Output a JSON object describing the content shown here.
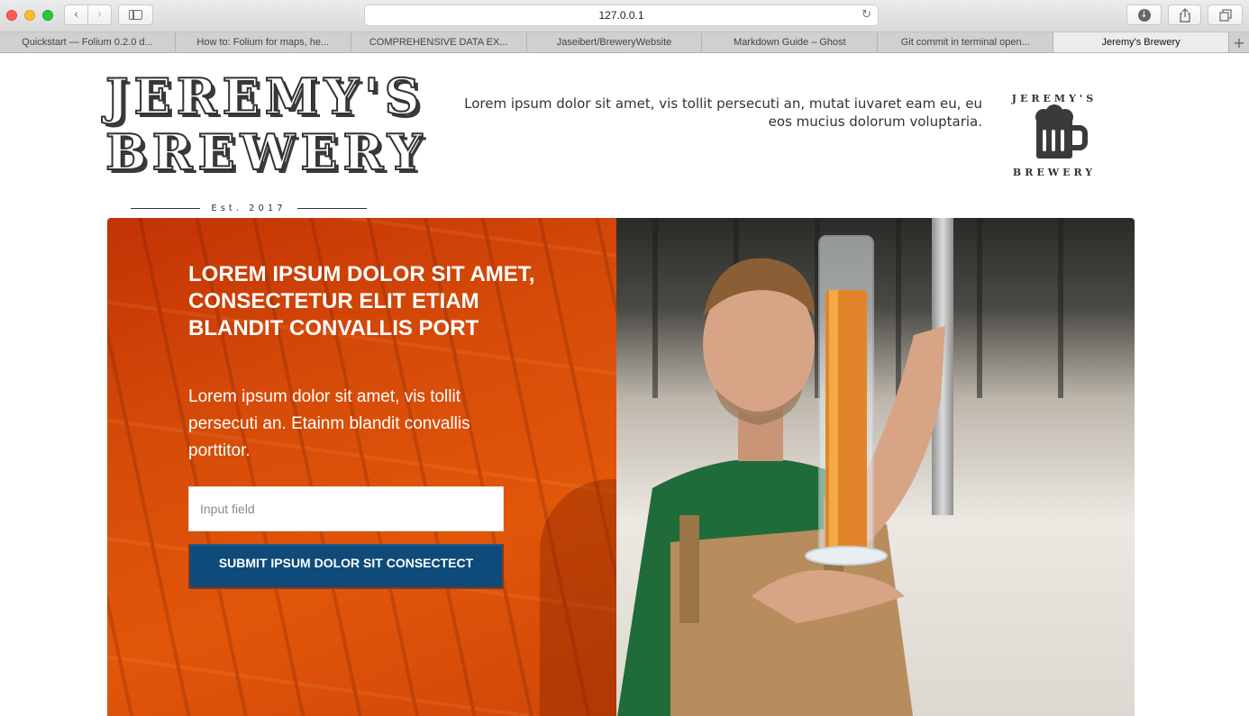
{
  "browser": {
    "url": "127.0.0.1",
    "tabs": [
      {
        "title": "Quickstart — Folium 0.2.0 d...",
        "active": false
      },
      {
        "title": "How to: Folium for maps, he...",
        "active": false
      },
      {
        "title": "COMPREHENSIVE DATA EX...",
        "active": false
      },
      {
        "title": "Jaseibert/BreweryWebsite",
        "active": false
      },
      {
        "title": "Markdown Guide – Ghost",
        "active": false
      },
      {
        "title": "Git commit in terminal open...",
        "active": false
      },
      {
        "title": "Jeremy's Brewery",
        "active": true
      }
    ],
    "icons": {
      "back": "chevron-left-icon",
      "forward": "chevron-right-icon",
      "sidebar": "sidebar-icon",
      "reload": "reload-icon",
      "download": "download-icon",
      "share": "share-icon",
      "tabs": "tabs-overview-icon",
      "new_tab": "plus-icon"
    }
  },
  "header": {
    "logo_line1": "JEREMY'S",
    "logo_line2": "BREWERY",
    "established": "Est. 2017",
    "tagline": "Lorem ipsum dolor sit amet, vis tollit persecuti an, mutat iuvaret eam eu, eu eos mucius dolorum voluptaria.",
    "badge_top": "JEREMY'S",
    "badge_bottom": "BREWERY"
  },
  "hero": {
    "title": "LOREM IPSUM DOLOR SIT AMET, CONSECTETUR ELIT ETIAM BLANDIT CONVALLIS PORT",
    "body": "Lorem ipsum dolor sit amet, vis tollit persecuti an. Etainm blandit convallis porttitor.",
    "input_placeholder": "Input field",
    "input_value": "",
    "submit_label": "SUBMIT IPSUM DOLOR SIT CONSECTECT"
  },
  "colors": {
    "hero_orange": "#d64b08",
    "submit_blue": "#0e4b7a",
    "text_dark": "#333333"
  }
}
